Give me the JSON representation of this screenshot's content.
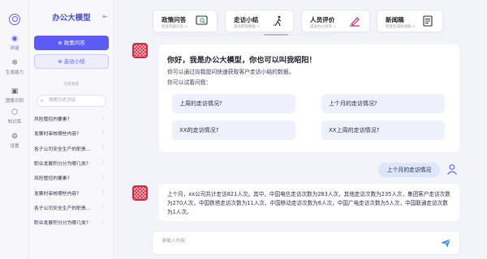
{
  "rail": {
    "items": [
      {
        "label": "对话",
        "icon": "chat-icon"
      },
      {
        "label": "生成能力",
        "icon": "sparkle-icon"
      },
      {
        "label": "图像识别",
        "icon": "image-scan-icon"
      },
      {
        "label": "知识库",
        "icon": "knowledge-box-icon"
      },
      {
        "label": "设置",
        "icon": "gear-icon"
      }
    ]
  },
  "sidebar": {
    "brand": "办公大模型",
    "primary_button": "政策问答",
    "secondary_button": "走访小结",
    "history_title": "历史会话",
    "search_placeholder": "搜索历史对话",
    "history": [
      "风险管控的要素?",
      "发票时审核哪些内容?",
      "各子公司安全生产的职责...",
      "职业发展积分分为哪几类?",
      "风险管控的要素?",
      "发票时审核哪些内容?",
      "各子公司安全生产的职责...",
      "职业发展积分分为哪几类?"
    ]
  },
  "top_cards": [
    {
      "title": "政策问答",
      "subtitle": "智能答疑问答 >",
      "icon": "chat-search-icon"
    },
    {
      "title": "走访小结",
      "subtitle": "高效获取数据 >",
      "icon": "walking-person-icon"
    },
    {
      "title": "人员评价",
      "subtitle": "提高办公效率 >",
      "icon": "pen-sign-icon"
    },
    {
      "title": "新闻稿",
      "subtitle": "智能生成新闻稿 >",
      "icon": "document-edit-icon"
    }
  ],
  "welcome": {
    "title": "你好，我是办公大模型，你也可以叫我昭阳！",
    "line1": "你可以通过向我提问快速获取客户走访小结的数据。",
    "line2": "你可以试着问我：",
    "suggestions": [
      "上周的走访情况?",
      "上个月的走访情况?",
      "XX的走访情况?",
      "XX上周的走访情况?"
    ]
  },
  "user_message": "上个月的走访情况",
  "answer": {
    "text": "上个月，xx公司共计走访821人次。其中，中国电信走访次数为283人次，其他走访次数为235人次，集团客户走访次数为270人次，中国铁塔走访次数为11人次，中国移动走访次数为6人次，中国广电走访次数为5人次，中国联通走访次数为1人次。"
  },
  "input": {
    "placeholder": "请输入内容"
  },
  "colors": {
    "accent": "#5c5cf5",
    "bot_avatar": "#d7263d",
    "background": "#f3f4fa"
  }
}
